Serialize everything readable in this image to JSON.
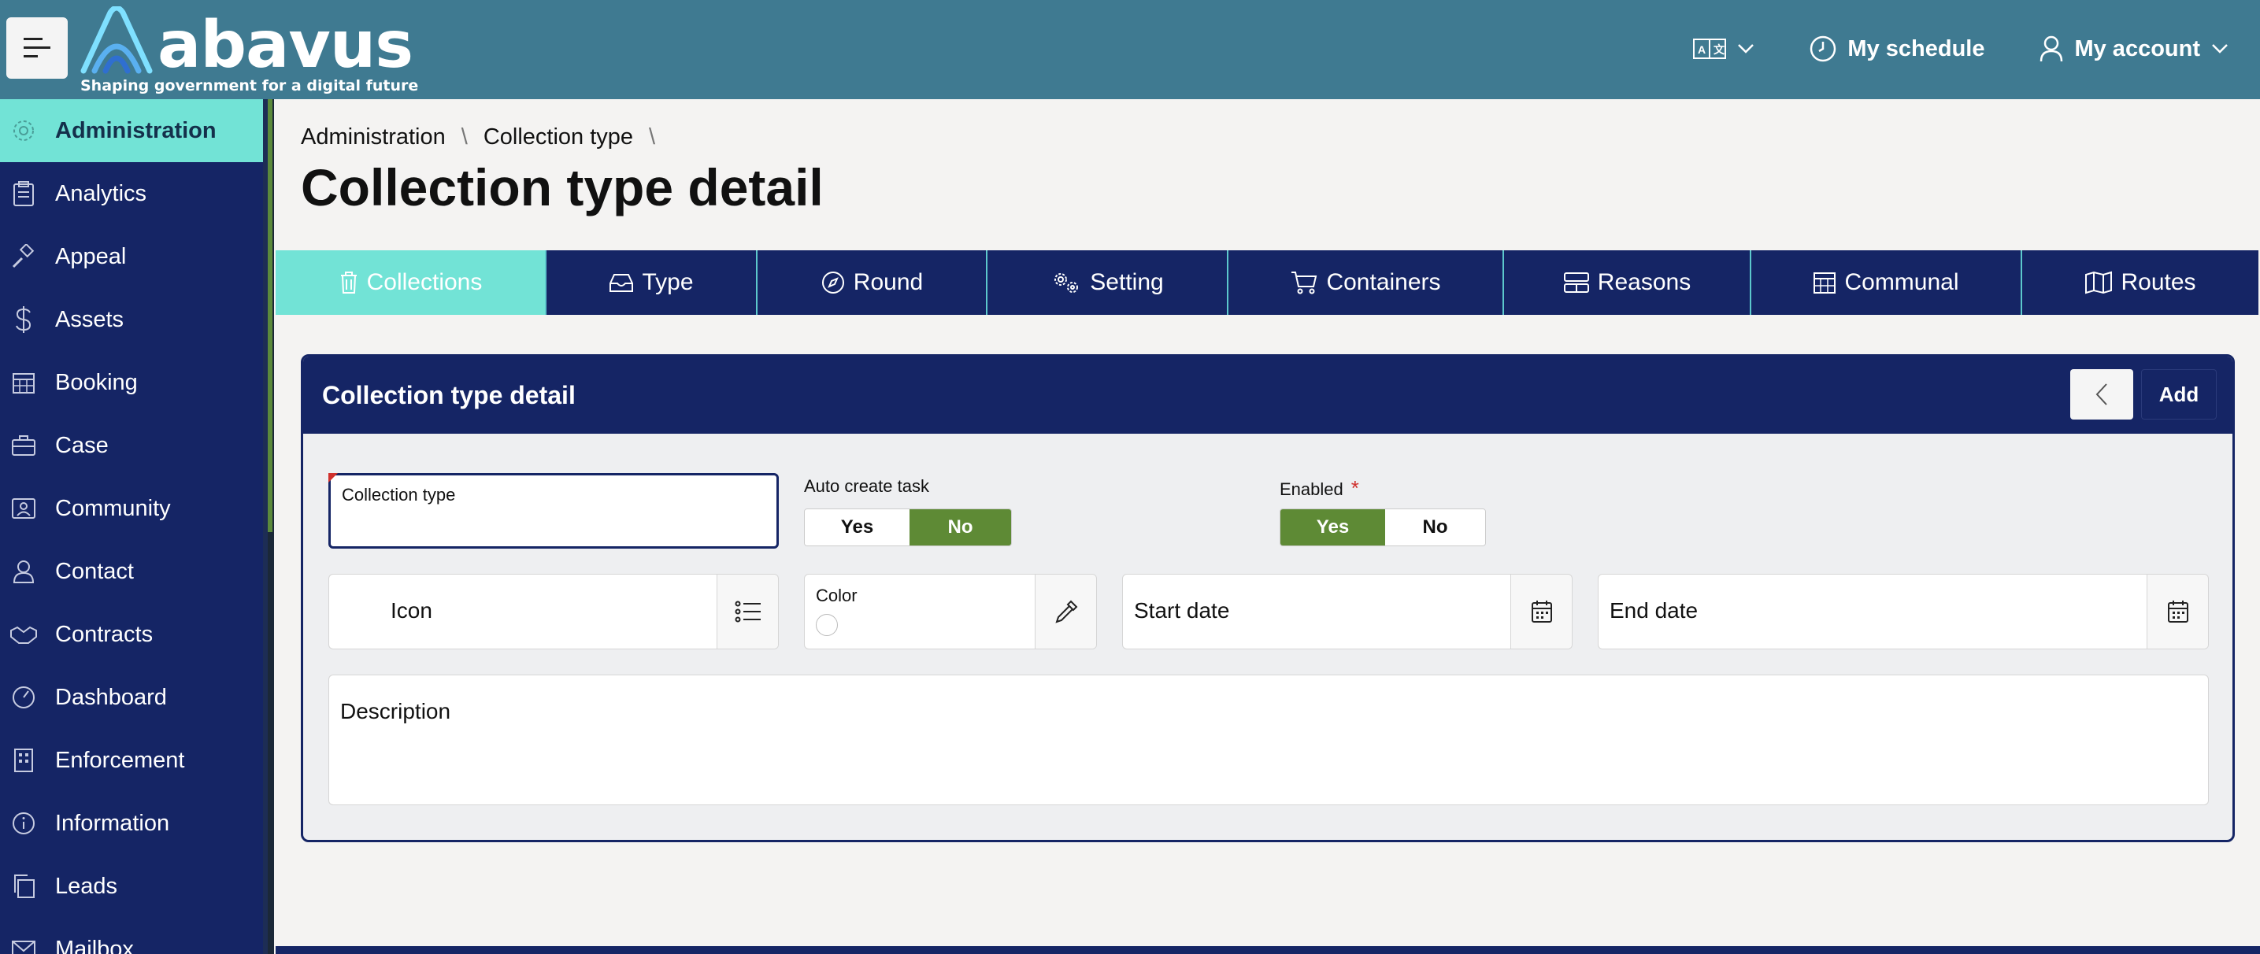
{
  "header": {
    "brand": "abavus",
    "tagline": "Shaping government for a digital future",
    "schedule_label": "My schedule",
    "account_label": "My account"
  },
  "sidebar": {
    "items": [
      {
        "label": "Administration",
        "icon": "gear-icon"
      },
      {
        "label": "Analytics",
        "icon": "clipboard-icon"
      },
      {
        "label": "Appeal",
        "icon": "gavel-icon"
      },
      {
        "label": "Assets",
        "icon": "dollar-icon"
      },
      {
        "label": "Booking",
        "icon": "calendar-icon"
      },
      {
        "label": "Case",
        "icon": "briefcase-icon"
      },
      {
        "label": "Community",
        "icon": "person-card-icon"
      },
      {
        "label": "Contact",
        "icon": "person-icon"
      },
      {
        "label": "Contracts",
        "icon": "handshake-icon"
      },
      {
        "label": "Dashboard",
        "icon": "gauge-icon"
      },
      {
        "label": "Enforcement",
        "icon": "building-icon"
      },
      {
        "label": "Information",
        "icon": "info-icon"
      },
      {
        "label": "Leads",
        "icon": "copy-icon"
      },
      {
        "label": "Mailbox",
        "icon": "mail-icon"
      }
    ]
  },
  "breadcrumb": [
    "Administration",
    "Collection type"
  ],
  "page_title": "Collection type detail",
  "tabs": [
    {
      "label": "Collections",
      "icon": "trash-icon"
    },
    {
      "label": "Type",
      "icon": "tray-icon"
    },
    {
      "label": "Round",
      "icon": "compass-icon"
    },
    {
      "label": "Setting",
      "icon": "gears-icon"
    },
    {
      "label": "Containers",
      "icon": "cart-icon"
    },
    {
      "label": "Reasons",
      "icon": "list-box-icon"
    },
    {
      "label": "Communal",
      "icon": "calendar-grid-icon"
    },
    {
      "label": "Routes",
      "icon": "map-icon"
    }
  ],
  "panel": {
    "title": "Collection type detail",
    "add_label": "Add"
  },
  "form": {
    "collection_type_label": "Collection type",
    "collection_type_value": "",
    "auto_create_label": "Auto create task",
    "auto_create_yes": "Yes",
    "auto_create_no": "No",
    "auto_create_selected": "No",
    "enabled_label": "Enabled",
    "enabled_required": "*",
    "enabled_yes": "Yes",
    "enabled_no": "No",
    "enabled_selected": "Yes",
    "icon_placeholder": "Icon",
    "color_label": "Color",
    "start_date_placeholder": "Start date",
    "end_date_placeholder": "End date",
    "description_placeholder": "Description"
  },
  "colors": {
    "header_bg": "#3f7a91",
    "sidebar_bg": "#152565",
    "active_teal": "#72e3d6",
    "toggle_green": "#5e8a35",
    "required_red": "#d0312d"
  }
}
